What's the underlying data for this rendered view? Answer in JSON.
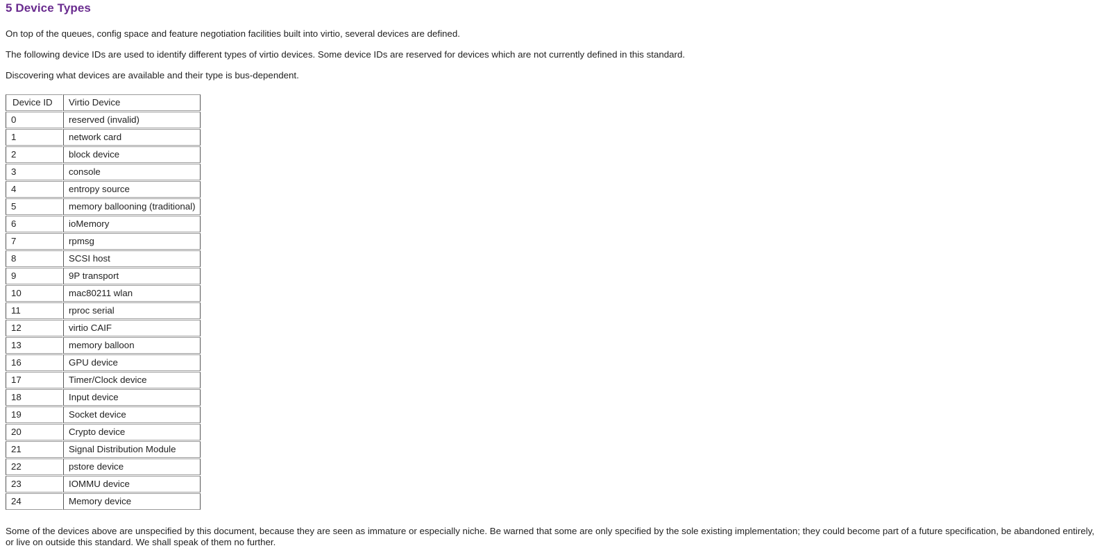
{
  "heading": "5 Device Types",
  "intro_paragraphs": [
    "On top of the queues, config space and feature negotiation facilities built into virtio, several devices are defined.",
    "The following device IDs are used to identify different types of virtio devices. Some device IDs are reserved for devices which are not currently defined in this standard.",
    "Discovering what devices are available and their type is bus-dependent."
  ],
  "table": {
    "columns": [
      "Device ID",
      "Virtio Device"
    ],
    "rows": [
      [
        "0",
        "reserved (invalid)"
      ],
      [
        "1",
        "network card"
      ],
      [
        "2",
        "block device"
      ],
      [
        "3",
        "console"
      ],
      [
        "4",
        "entropy source"
      ],
      [
        "5",
        "memory ballooning (traditional)"
      ],
      [
        "6",
        "ioMemory"
      ],
      [
        "7",
        "rpmsg"
      ],
      [
        "8",
        "SCSI host"
      ],
      [
        "9",
        "9P transport"
      ],
      [
        "10",
        "mac80211 wlan"
      ],
      [
        "11",
        "rproc serial"
      ],
      [
        "12",
        "virtio CAIF"
      ],
      [
        "13",
        "memory balloon"
      ],
      [
        "16",
        "GPU device"
      ],
      [
        "17",
        "Timer/Clock device"
      ],
      [
        "18",
        "Input device"
      ],
      [
        "19",
        "Socket device"
      ],
      [
        "20",
        "Crypto device"
      ],
      [
        "21",
        "Signal Distribution Module"
      ],
      [
        "22",
        "pstore device"
      ],
      [
        "23",
        "IOMMU device"
      ],
      [
        "24",
        "Memory device"
      ]
    ]
  },
  "footer_paragraph": "Some of the devices above are unspecified by this document, because they are seen as immature or especially niche. Be warned that some are only specified by the sole existing implementation; they could become part of a future specification, be abandoned entirely, or live on outside this standard. We shall speak of them no further.",
  "colors": {
    "heading": "#6a2c8f",
    "body_text": "#222222",
    "cell_border_horizontal": "#9a9a9a",
    "cell_border_vertical": "#555555",
    "background": "#ffffff"
  }
}
